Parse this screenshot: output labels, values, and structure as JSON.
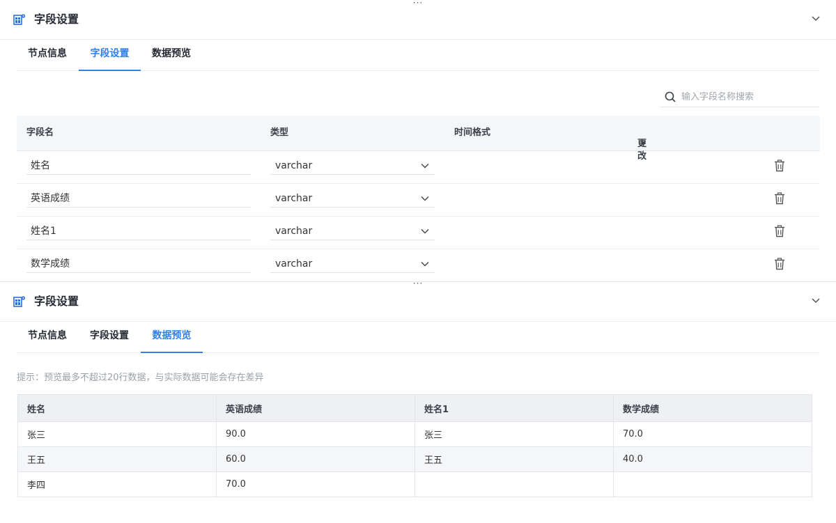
{
  "top_panel": {
    "title": "字段设置",
    "tabs": [
      {
        "label": "节点信息"
      },
      {
        "label": "字段设置"
      },
      {
        "label": "数据预览"
      }
    ],
    "active_tab": "字段设置",
    "search": {
      "placeholder": "输入字段名称搜索",
      "value": ""
    },
    "columns": {
      "name": "字段名",
      "type": "类型",
      "time_format": "时间格式",
      "change": "更改"
    },
    "fields": [
      {
        "name": "姓名",
        "type": "varchar"
      },
      {
        "name": "英语成绩",
        "type": "varchar"
      },
      {
        "name": "姓名1",
        "type": "varchar"
      },
      {
        "name": "数学成绩",
        "type": "varchar"
      }
    ]
  },
  "bottom_panel": {
    "title": "字段设置",
    "tabs": [
      {
        "label": "节点信息"
      },
      {
        "label": "字段设置"
      },
      {
        "label": "数据预览"
      }
    ],
    "active_tab": "数据预览",
    "hint": "提示：预览最多不超过20行数据，与实际数据可能会存在差异",
    "preview": {
      "headers": [
        "姓名",
        "英语成绩",
        "姓名1",
        "数学成绩"
      ],
      "rows": [
        [
          "张三",
          "90.0",
          "张三",
          "70.0"
        ],
        [
          "王五",
          "60.0",
          "王五",
          "40.0"
        ],
        [
          "李四",
          "70.0",
          "",
          ""
        ]
      ]
    }
  },
  "icons": {
    "panel": "table-settings-icon",
    "collapse": "chevron-down-icon",
    "search": "search-icon",
    "dropdown": "chevron-down-icon",
    "delete": "trash-icon",
    "sort": "caret-down-icon",
    "resize": "drag-handle-dots-icon"
  },
  "colors": {
    "accent": "#2f80ed",
    "header_bg": "#f5f6f8",
    "hint": "#9ba0a8"
  }
}
